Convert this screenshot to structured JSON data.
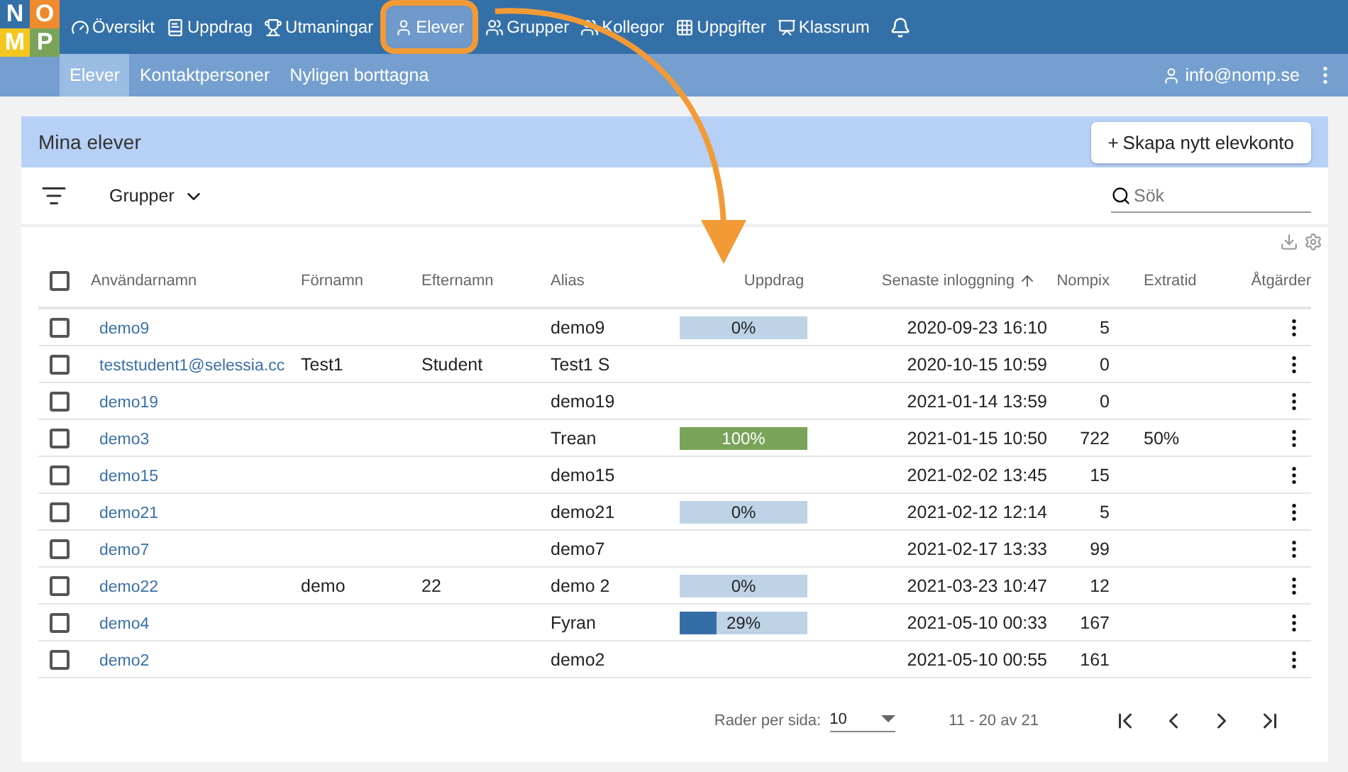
{
  "logo": {
    "letters": [
      "N",
      "O",
      "M",
      "P"
    ]
  },
  "nav": [
    {
      "label": "Översikt",
      "selected": false
    },
    {
      "label": "Uppdrag",
      "selected": false
    },
    {
      "label": "Utmaningar",
      "selected": false
    },
    {
      "label": "Elever",
      "selected": true
    },
    {
      "label": "Grupper",
      "selected": false
    },
    {
      "label": "Kollegor",
      "selected": false
    },
    {
      "label": "Uppgifter",
      "selected": false
    },
    {
      "label": "Klassrum",
      "selected": false
    }
  ],
  "subnav": [
    {
      "label": "Elever",
      "selected": true
    },
    {
      "label": "Kontaktpersoner",
      "selected": false
    },
    {
      "label": "Nyligen borttagna",
      "selected": false
    }
  ],
  "account": "info@nomp.se",
  "panel": {
    "title": "Mina elever",
    "create_button": "Skapa nytt elevkonto",
    "create_icon": "+"
  },
  "filter": {
    "label": "Grupper"
  },
  "search": {
    "placeholder": "Sök"
  },
  "table": {
    "all_checked": false,
    "columns": [
      {
        "label": "Användarnamn",
        "sorted": false
      },
      {
        "label": "Förnamn",
        "sorted": false
      },
      {
        "label": "Efternamn",
        "sorted": false
      },
      {
        "label": "Alias",
        "sorted": false
      },
      {
        "label": "Uppdrag",
        "sorted": false
      },
      {
        "label": "Senaste inloggning",
        "sorted": true
      },
      {
        "label": "Nompix",
        "sorted": false
      },
      {
        "label": "Extratid",
        "sorted": false
      },
      {
        "label": "Åtgärder",
        "sorted": false
      }
    ],
    "rows": [
      {
        "checked": false,
        "username": "demo9",
        "first": "",
        "last": "",
        "alias": "demo9",
        "progress": {
          "level": 0,
          "label": "0%"
        },
        "login": "2020-09-23 16:10",
        "nompix": "5",
        "extra": ""
      },
      {
        "checked": false,
        "username": "teststudent1@selessia.cc",
        "first": "Test1",
        "last": "Student",
        "alias": "Test1 S",
        "login": "2020-10-15 10:59",
        "nompix": "0",
        "extra": ""
      },
      {
        "checked": false,
        "username": "demo19",
        "first": "",
        "last": "",
        "alias": "demo19",
        "login": "2021-01-14 13:59",
        "nompix": "0",
        "extra": ""
      },
      {
        "checked": false,
        "username": "demo3",
        "first": "",
        "last": "",
        "alias": "Trean",
        "progress": {
          "level": 1,
          "label": "100%"
        },
        "login": "2021-01-15 10:50",
        "nompix": "722",
        "extra": "50%"
      },
      {
        "checked": false,
        "username": "demo15",
        "first": "",
        "last": "",
        "alias": "demo15",
        "login": "2021-02-02 13:45",
        "nompix": "15",
        "extra": ""
      },
      {
        "checked": false,
        "username": "demo21",
        "first": "",
        "last": "",
        "alias": "demo21",
        "progress": {
          "level": 0,
          "label": "0%"
        },
        "login": "2021-02-12 12:14",
        "nompix": "5",
        "extra": ""
      },
      {
        "checked": false,
        "username": "demo7",
        "first": "",
        "last": "",
        "alias": "demo7",
        "login": "2021-02-17 13:33",
        "nompix": "99",
        "extra": ""
      },
      {
        "checked": false,
        "username": "demo22",
        "first": "demo",
        "last": "22",
        "alias": "demo 2",
        "progress": {
          "level": 0,
          "label": "0%"
        },
        "login": "2021-03-23 10:47",
        "nompix": "12",
        "extra": ""
      },
      {
        "checked": false,
        "username": "demo4",
        "first": "",
        "last": "",
        "alias": "Fyran",
        "progress": {
          "level": 0.29,
          "label": "29%"
        },
        "login": "2021-05-10 00:33",
        "nompix": "167",
        "extra": ""
      },
      {
        "checked": false,
        "username": "demo2",
        "first": "",
        "last": "",
        "alias": "demo2",
        "login": "2021-05-10 00:55",
        "nompix": "161",
        "extra": ""
      }
    ]
  },
  "pagination": {
    "rows_label": "Rader per sida:",
    "rows_value": "10",
    "range": "11 - 20 av 21"
  }
}
